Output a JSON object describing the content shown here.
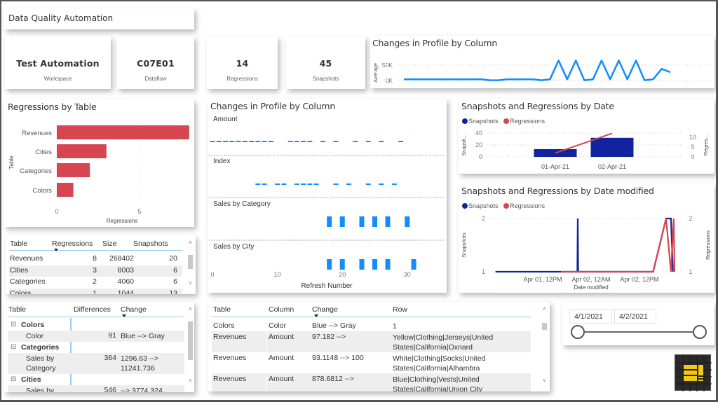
{
  "header": {
    "title": "Data Quality Automation"
  },
  "kpis": [
    {
      "value": "Test Automation",
      "label": "Workspace"
    },
    {
      "value": "C07E01",
      "label": "Dataflow"
    },
    {
      "value": "14",
      "label": "Regressions"
    },
    {
      "value": "45",
      "label": "Snapshots"
    }
  ],
  "colors": {
    "blue": "#118dff",
    "navy": "#12239e",
    "red": "#d64550",
    "logo_yellow": "#f2c811"
  },
  "chart_data": [
    {
      "id": "changes_top",
      "type": "line",
      "title": "Changes in Profile by Column",
      "xlabel": "",
      "ylabel": "Average",
      "yticks": [
        "0K",
        "50K"
      ],
      "ylim": [
        0,
        50000
      ],
      "x": [
        0,
        1,
        2,
        3,
        4,
        5,
        6,
        7,
        8,
        9,
        10,
        11,
        12,
        13,
        14,
        15,
        16,
        17,
        18,
        19,
        20,
        21,
        22,
        23,
        24,
        25,
        26,
        27,
        28,
        29,
        30,
        31
      ],
      "values": [
        4000,
        4000,
        4000,
        4000,
        4000,
        4000,
        4000,
        4000,
        4000,
        4000,
        1000,
        1000,
        4000,
        4000,
        4000,
        4000,
        1000,
        4000,
        65000,
        4000,
        65000,
        1000,
        4000,
        65000,
        4000,
        65000,
        4000,
        65000,
        1000,
        4000,
        38000,
        27000
      ]
    },
    {
      "id": "regressions_by_table",
      "type": "bar",
      "orientation": "horizontal",
      "title": "Regressions by Table",
      "xlabel": "Regressions",
      "ylabel": "Table",
      "categories": [
        "Revenues",
        "Cities",
        "Categories",
        "Colors"
      ],
      "values": [
        8,
        3,
        2,
        1
      ],
      "xticks": [
        "0",
        "5"
      ],
      "xlim": [
        0,
        8
      ]
    },
    {
      "id": "changes_small_multiples",
      "type": "scatter",
      "title": "Changes in Profile by Column",
      "xlabel": "Refresh Number",
      "xticks": [
        "0",
        "10",
        "20",
        "30"
      ],
      "xlim": [
        0,
        35
      ],
      "panels": [
        {
          "name": "Amount",
          "style": "dash",
          "x": [
            0,
            1,
            2,
            3,
            4,
            5,
            6,
            7,
            8,
            9,
            12,
            13,
            14,
            15,
            17,
            19,
            22,
            24,
            26,
            29
          ]
        },
        {
          "name": "Index",
          "style": "dash",
          "x": [
            7,
            8,
            10,
            11,
            13,
            14,
            15,
            16,
            19,
            21,
            24,
            26,
            28
          ]
        },
        {
          "name": "Sales by Category",
          "style": "block",
          "x": [
            18,
            20,
            23,
            25,
            27,
            30
          ]
        },
        {
          "name": "Sales by City",
          "style": "block",
          "x": [
            18,
            20,
            23,
            25,
            27,
            31
          ]
        }
      ]
    },
    {
      "id": "by_date",
      "type": "bar",
      "title": "Snapshots and Regressions by Date",
      "legend": [
        "Snapshots",
        "Regressions"
      ],
      "legend_position": "top-left",
      "categories": [
        "01-Apr-21",
        "02-Apr-21"
      ],
      "series": [
        {
          "name": "Snapshots",
          "kind": "bar",
          "axis": "left",
          "values": [
            13,
            32
          ]
        },
        {
          "name": "Regressions",
          "kind": "line",
          "axis": "right",
          "values": [
            2,
            12
          ]
        }
      ],
      "ylabel": "Snapsh...",
      "ylabel_right": "Regres...",
      "yticks": [
        "0",
        "20",
        "40"
      ],
      "yticks_right": [
        "0",
        "5",
        "10"
      ],
      "ylim": [
        0,
        40
      ],
      "ylim_right": [
        0,
        10
      ]
    },
    {
      "id": "by_date_modified",
      "type": "line",
      "title": "Snapshots and Regressions by Date modified",
      "legend": [
        "Snapshots",
        "Regressions"
      ],
      "legend_position": "top-left",
      "xlabel": "Date modified",
      "ylabel": "Snapshots",
      "ylabel_right": "Regressions",
      "xticks": [
        {
          "label": "Apr 01, 12PM",
          "hours": 12
        },
        {
          "label": "Apr 02, 12AM",
          "hours": 24
        },
        {
          "label": "Apr 02, 12PM",
          "hours": 36
        }
      ],
      "x_unit": "hours since Apr 01 12AM",
      "xlim": [
        0,
        46
      ],
      "yticks": [
        "1",
        "2"
      ],
      "yticks_right": [
        "1",
        "2"
      ],
      "ylim": [
        1,
        2
      ],
      "series": [
        {
          "name": "Snapshots",
          "points": [
            [
              0.3,
              1
            ],
            [
              20.6,
              1
            ],
            [
              20.7,
              2
            ],
            [
              20.8,
              1
            ],
            [
              39.4,
              1
            ],
            [
              42.6,
              2
            ],
            [
              43.8,
              2
            ],
            [
              44.3,
              1
            ]
          ]
        },
        {
          "name": "Regressions",
          "points": [
            [
              16.5,
              1
            ],
            [
              39.4,
              1
            ],
            [
              42.6,
              2
            ],
            [
              43.8,
              1
            ],
            [
              44.5,
              2
            ],
            [
              44.7,
              1
            ]
          ]
        }
      ]
    }
  ],
  "regressions_table": {
    "columns": [
      "Table",
      "Regressions",
      "Size",
      "Snapshots"
    ],
    "sorted_column": "Regressions",
    "rows": [
      [
        "Revenues",
        "8",
        "268402",
        "20"
      ],
      [
        "Cities",
        "3",
        "8003",
        "6"
      ],
      [
        "Categories",
        "2",
        "4060",
        "6"
      ],
      [
        "Colors",
        "1",
        "1044",
        "13"
      ]
    ]
  },
  "differences_matrix": {
    "columns": [
      "Table",
      "Differences",
      "Change"
    ],
    "sorted_column": "Change",
    "groups": [
      {
        "name": "Colors",
        "rows": [
          {
            "column": "Color",
            "differences": "91",
            "change": "Blue --> Gray"
          }
        ]
      },
      {
        "name": "Categories",
        "rows": [
          {
            "column": "Sales by Category",
            "differences": "364",
            "change": "1296.63 --> 11241.736"
          }
        ]
      },
      {
        "name": "Cities",
        "rows": [
          {
            "column": "Sales by",
            "differences": "546",
            "change": "--> 3774.324"
          }
        ]
      }
    ],
    "expand_glyph": "⊟"
  },
  "changes_table": {
    "columns": [
      "Table",
      "Column",
      "Change",
      "Row"
    ],
    "sorted_column": "Change",
    "rows": [
      [
        "Colors",
        "Color",
        "Blue --> Gray",
        "1"
      ],
      [
        "Revenues",
        "Amount",
        "97.182 -->",
        "Yellow|Clothing|Jerseys|United States|California|Oxnard"
      ],
      [
        "Revenues",
        "Amount",
        "93.1148 --> 100",
        "White|Clothing|Socks|United States|California|Alhambra"
      ],
      [
        "Revenues",
        "Amount",
        "878.6812 -->",
        "Blue|Clothing|Vests|United States|California|Union City"
      ]
    ]
  },
  "date_slicer": {
    "start": "4/1/2021",
    "end": "4/2/2021",
    "range_selected": [
      0,
      1
    ]
  },
  "logo": {
    "icon": "power-bi-report-icon"
  }
}
